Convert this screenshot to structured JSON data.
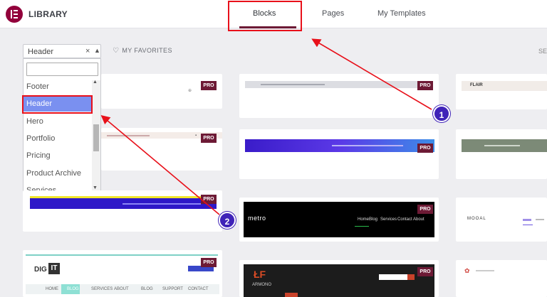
{
  "header": {
    "title": "LIBRARY",
    "tabs": [
      {
        "label": "Blocks",
        "active": true
      },
      {
        "label": "Pages",
        "active": false
      },
      {
        "label": "My Templates",
        "active": false
      }
    ],
    "accent_color": "#92003b"
  },
  "filter": {
    "selected": "Header",
    "clear_symbol": "×",
    "caret_symbol": "▲",
    "search_placeholder": "",
    "options": [
      "Footer",
      "Header",
      "Hero",
      "Portfolio",
      "Pricing",
      "Product Archive",
      "Services"
    ],
    "highlighted": "Header"
  },
  "favorites": {
    "label": "MY FAVORITES",
    "icon": "heart-icon"
  },
  "search_label_partial": "SE",
  "badge": "PRO",
  "cards": {
    "metro_logo": "metro",
    "digit_logo_a": "DIG",
    "digit_logo_b": "IT",
    "moonal_logo": "MOOAL",
    "flair_logo": "FLAIR",
    "arrow_logo": "ARMONO",
    "digit_nav": [
      "HOME",
      "BLOG",
      "SERVICES",
      "ABOUT",
      "BLOG",
      "SUPPORT",
      "CONTACT"
    ],
    "metro_nav": [
      "Home",
      "Blog",
      "Services",
      "Contact",
      "About"
    ]
  },
  "callouts": [
    "1",
    "2"
  ],
  "colors": {
    "highlight_red": "#e8101a",
    "callout_purple": "#3f23b8",
    "pro_badge": "#6d1a35",
    "selected_option": "#7a90f0"
  }
}
